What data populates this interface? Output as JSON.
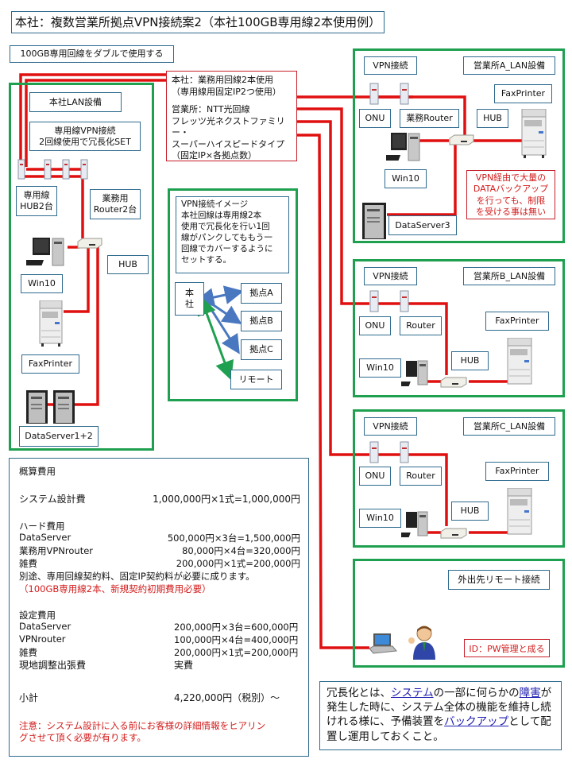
{
  "title": "本社：複数営業所拠点VPN接続案2（本社100GB専用線2本使用例）",
  "subtitle": "100GB専用回線をダブルで使用する",
  "line_note": {
    "hq": [
      "本社：業務用回線2本使用",
      "（専用線用固定IP2つ使用）"
    ],
    "branch": [
      "営業所：NTT光回線",
      "フレッツ光ネクストファミリー・",
      "スーパーハイスピードタイプ",
      "（固定IP×各拠点数）"
    ]
  },
  "hq_lan": {
    "title": "本社LAN設備",
    "vpn_set": [
      "専用線VPN接続",
      "2回線使用で冗長化SET"
    ],
    "hub_dedicated": [
      "専用線",
      "HUB2台"
    ],
    "router_business": [
      "業務用",
      "Router2台"
    ],
    "hub": "HUB",
    "pc": "Win10",
    "printer": "FaxPrinter",
    "server": "DataServer1+2"
  },
  "vpn_image": {
    "description": [
      "VPN接続イメージ",
      "本社回線は専用線2本",
      "使用で冗長化を行い1回",
      "線がパンクしてももう一",
      "回線でカバーするように",
      "セットする。"
    ],
    "hq_node": [
      "本",
      "社"
    ],
    "nodes": [
      "拠点A",
      "拠点B",
      "拠点C",
      "リモート"
    ]
  },
  "branches": [
    {
      "title": "営業所A_LAN設備",
      "vpn": "VPN接続",
      "onu": "ONU",
      "router": "業務Router",
      "hub": "HUB",
      "pc": "Win10",
      "printer": "FaxPrinter",
      "server": "DataServer3",
      "note": [
        "VPN経由で大量の",
        "DATAバックアップ",
        "を行っても、制限",
        "を受ける事は無い"
      ]
    },
    {
      "title": "営業所B_LAN設備",
      "vpn": "VPN接続",
      "onu": "ONU",
      "router": "Router",
      "hub": "HUB",
      "pc": "Win10",
      "printer": "FaxPrinter"
    },
    {
      "title": "営業所C_LAN設備",
      "vpn": "VPN接続",
      "onu": "ONU",
      "router": "Router",
      "hub": "HUB",
      "pc": "Win10",
      "printer": "FaxPrinter"
    }
  ],
  "remote": {
    "title": "外出先リモート接続",
    "note": "ID：PW管理と成る"
  },
  "cost": {
    "heading": "概算費用",
    "design": {
      "label": "システム設計費",
      "value": "1,000,000円×1式=1,000,000円"
    },
    "hardware_heading": "ハード費用",
    "hardware": [
      {
        "label": "DataServer",
        "value": "500,000円×3台=1,500,000円"
      },
      {
        "label": "業務用VPNrouter",
        "value": "80,000円×4台=320,000円"
      },
      {
        "label": "雑費",
        "value": "200,000円×1式=200,000円"
      }
    ],
    "hardware_note": "別途、専用回線契約料、固定IP契約料が必要に成ります。",
    "hardware_note_red": "（100GB専用線2本、新規契約初期費用必要）",
    "setup_heading": "設定費用",
    "setup": [
      {
        "label": "DataServer",
        "value": "200,000円×3台=600,000円"
      },
      {
        "label": "VPNrouter",
        "value": "100,000円×4台=400,000円"
      },
      {
        "label": "雑費",
        "value": "200,000円×1式=200,000円"
      },
      {
        "label": "現地調整出張費",
        "value": "実費"
      }
    ],
    "subtotal": {
      "label": "小計",
      "value": "4,220,000円（税別）～"
    },
    "warning": [
      "注意：システム設計に入る前にお客様の詳細情報をヒアリン",
      "グさせて頂く必要が有ります。"
    ]
  },
  "definition": {
    "parts": [
      {
        "t": "冗長化とは、",
        "link": false
      },
      {
        "t": "システム",
        "link": true
      },
      {
        "t": "の一部に何らかの",
        "link": false
      },
      {
        "t": "障害",
        "link": true
      },
      {
        "t": "が発生した時に、システム全体の機能を維持し続けれる様に、予備装置を",
        "link": false
      },
      {
        "t": "バックアップ",
        "link": true
      },
      {
        "t": "として配置し運用しておくこと。",
        "link": false
      }
    ]
  },
  "colors": {
    "group_border": "#1fa050",
    "label_border": "#2e6a8e",
    "wire": "#e01010",
    "arrow_blue": "#4a78c0",
    "arrow_green": "#1fa050",
    "note_red": "#d21c1c",
    "link": "#1a1ab0"
  }
}
